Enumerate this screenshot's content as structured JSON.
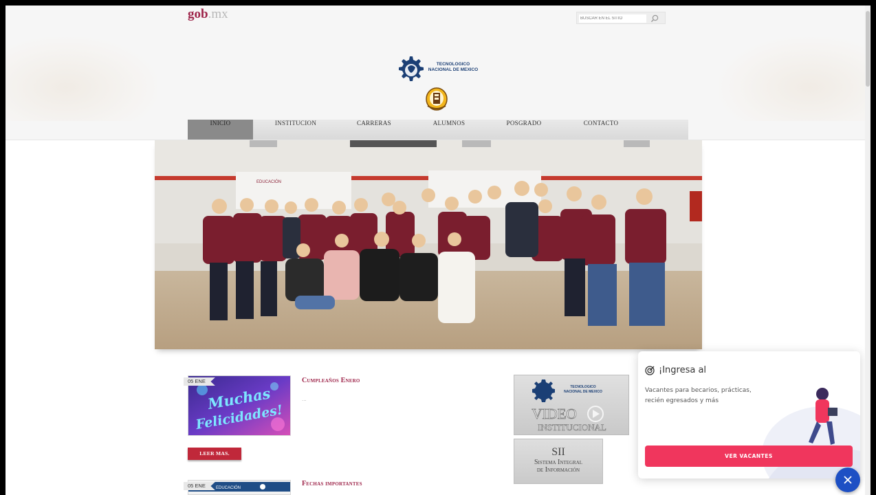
{
  "header": {
    "logo_main": "gob",
    "logo_suffix": ".mx",
    "search_placeholder": "BUSCAR EN EL SITIO",
    "institution_line1": "TECNOLOGICO",
    "institution_line2": "NACIONAL DE MEXICO"
  },
  "nav": {
    "items": [
      {
        "label": "INICIO",
        "active": true
      },
      {
        "label": "INSTITUCION"
      },
      {
        "label": "CARRERAS"
      },
      {
        "label": "ALUMNOS"
      },
      {
        "label": "POSGRADO"
      },
      {
        "label": "CONTACTO"
      }
    ]
  },
  "hero": {
    "banner_left": "EDUCACIÓN"
  },
  "news": [
    {
      "date": "05 ENE",
      "title": "Cumpleaños Enero",
      "image_text_1": "Muchas",
      "image_text_2": "Felicidades!",
      "excerpt": "..."
    },
    {
      "date": "05 ENE",
      "title": "Fechas importantes",
      "image_text_1": "EDUCACIÓN"
    }
  ],
  "read_more_label": "LEER MAS.",
  "sidebar": {
    "video_logo_line1": "TECNOLOGICO",
    "video_logo_line2": "NACIONAL DE MEXICO",
    "video_title": "VIDEO",
    "video_subtitle": "INSTITUCIONAL",
    "sii_title": "SII",
    "sii_line1": "Sistema Integral",
    "sii_line2": "de Información"
  },
  "popup": {
    "title": "¡Ingresa al",
    "description": "Vacantes para becarios, prácticas, recién egresados y más",
    "button_label": "VER VACANTES",
    "accent_color": "#f0365d"
  },
  "colors": {
    "brand": "#9d2449",
    "fab": "#1d4fc4"
  }
}
